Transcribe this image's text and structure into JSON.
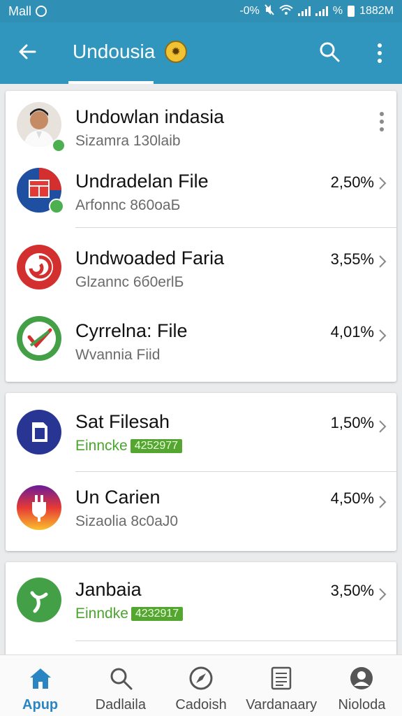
{
  "status_bar": {
    "carrier": "Mall",
    "left_icon": "sync-icon",
    "data": "-0%",
    "battery_pct": "%",
    "time": "1882M"
  },
  "app_bar": {
    "title": "Undousia",
    "back_icon": "arrow-left-icon",
    "search_icon": "search-icon",
    "more_icon": "more-vert-icon",
    "accent": "#3196bd"
  },
  "cards": [
    {
      "items": [
        {
          "title": "Undowlan indasia",
          "subtitle": "Sizamra 130laib",
          "percent": "",
          "icon": "profile-avatar",
          "has_menu": true
        },
        {
          "title": "Undradelan File",
          "subtitle": "Arfonnc 860oaБ",
          "percent": "2,50%",
          "icon": "calendar-app-icon"
        },
        {
          "title": "Undwoaded Faria",
          "subtitle": "Glzannc 6б0erlБ",
          "percent": "3,55%",
          "icon": "swirl-app-icon"
        },
        {
          "title": "Cyrrelna: File",
          "subtitle": "Wvannia Fiid",
          "percent": "4,01%",
          "icon": "check-app-icon"
        }
      ]
    },
    {
      "items": [
        {
          "title": "Sat Filesah",
          "subtitle": "Einncke",
          "badge": "4252977",
          "percent": "1,50%",
          "icon": "file-app-icon"
        },
        {
          "title": "Un Carien",
          "subtitle": "Sizaolia 8c0aJ0",
          "percent": "4,50%",
          "icon": "plug-app-icon"
        }
      ]
    },
    {
      "items": [
        {
          "title": "Janbaia",
          "subtitle": "Einndke",
          "badge": "4232917",
          "percent": "3,50%",
          "icon": "leaf-app-icon"
        }
      ]
    }
  ],
  "bottom_nav": [
    {
      "label": "Apup",
      "icon": "home-icon",
      "active": true
    },
    {
      "label": "Dadlaila",
      "icon": "search-icon",
      "active": false
    },
    {
      "label": "Cadoish",
      "icon": "compass-icon",
      "active": false
    },
    {
      "label": "Vardanaary",
      "icon": "document-icon",
      "active": false
    },
    {
      "label": "Nioloda",
      "icon": "profile-icon",
      "active": false
    }
  ]
}
